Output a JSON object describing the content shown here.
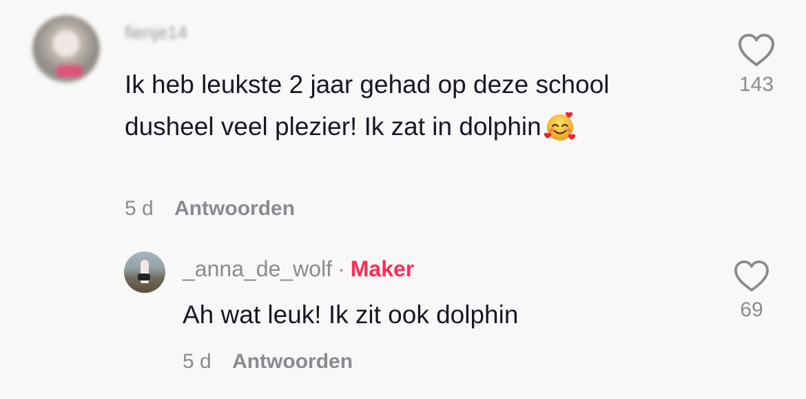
{
  "comment": {
    "username": "fienje14",
    "text": "Ik heb leukste 2 jaar gehad op deze school dusheel veel plezier! Ik zat in dolphin",
    "emoji": "smiling-face-with-hearts",
    "time": "5 d",
    "reply_label": "Antwoorden",
    "likes": "143"
  },
  "reply": {
    "username": "_anna_de_wolf",
    "separator": "·",
    "badge": "Maker",
    "text": "Ah wat leuk! Ik zit ook dolphin",
    "time": "5 d",
    "reply_label": "Antwoorden",
    "likes": "69"
  },
  "colors": {
    "background": "#f8f8f8",
    "text": "#161823",
    "muted": "#8a8b91",
    "maker_badge": "#fe2c55"
  }
}
